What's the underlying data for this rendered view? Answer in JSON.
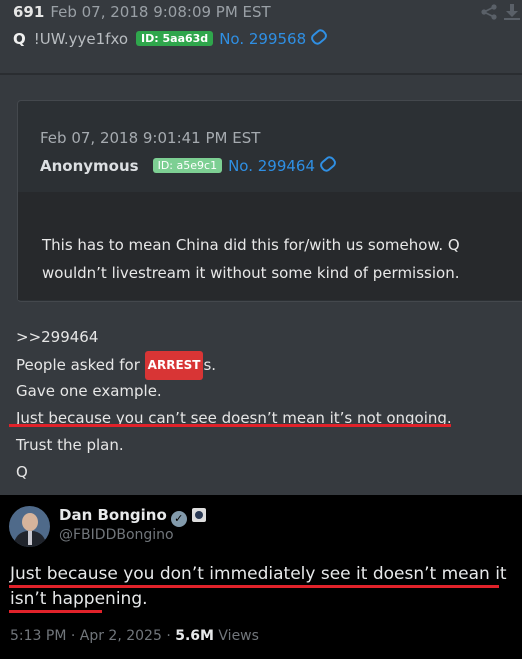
{
  "post": {
    "number": "691",
    "date": "Feb 07, 2018 9:08:09 PM EST",
    "author": "Q",
    "tripcode": "!UW.yye1fxo",
    "id": "ID: 5aa63d",
    "post_no": "No. 299568",
    "quoted": {
      "date": "Feb 07, 2018 9:01:41 PM EST",
      "author": "Anonymous",
      "id": "ID: a5e9c1",
      "post_no": "No. 299464",
      "text": "This has to mean China did this for/with us somehow.  Q wouldn’t livestream it without some kind of permission."
    },
    "lines": {
      "reply": ">>299464",
      "l2_pre": "People asked for ",
      "l2_badge": "ARREST",
      "l2_post": "s.",
      "l3": "Gave one example.",
      "l4": "Just because you can’t see doesn’t mean it’s not ongoing.",
      "l5": "Trust the plan.",
      "l6": "Q"
    }
  },
  "tweet": {
    "name": "Dan Bongino",
    "handle": "@FBIDDBongino",
    "text": "Just because you don’t immediately see it doesn’t mean it isn’t happening.",
    "time": "5:13 PM · Apr 2, 2025 · ",
    "views_count": "5.6M",
    "views_label": " Views"
  },
  "colors": {
    "panel_bg": "#363a3f",
    "id_badge": "#2fa64c",
    "link": "#2f8fe3",
    "highlight_underline": "#e0222a",
    "tweet_bg": "#000000"
  },
  "icons": [
    "share-icon",
    "download-icon",
    "link-chain-icon",
    "verified-badge-icon",
    "government-badge-icon"
  ]
}
